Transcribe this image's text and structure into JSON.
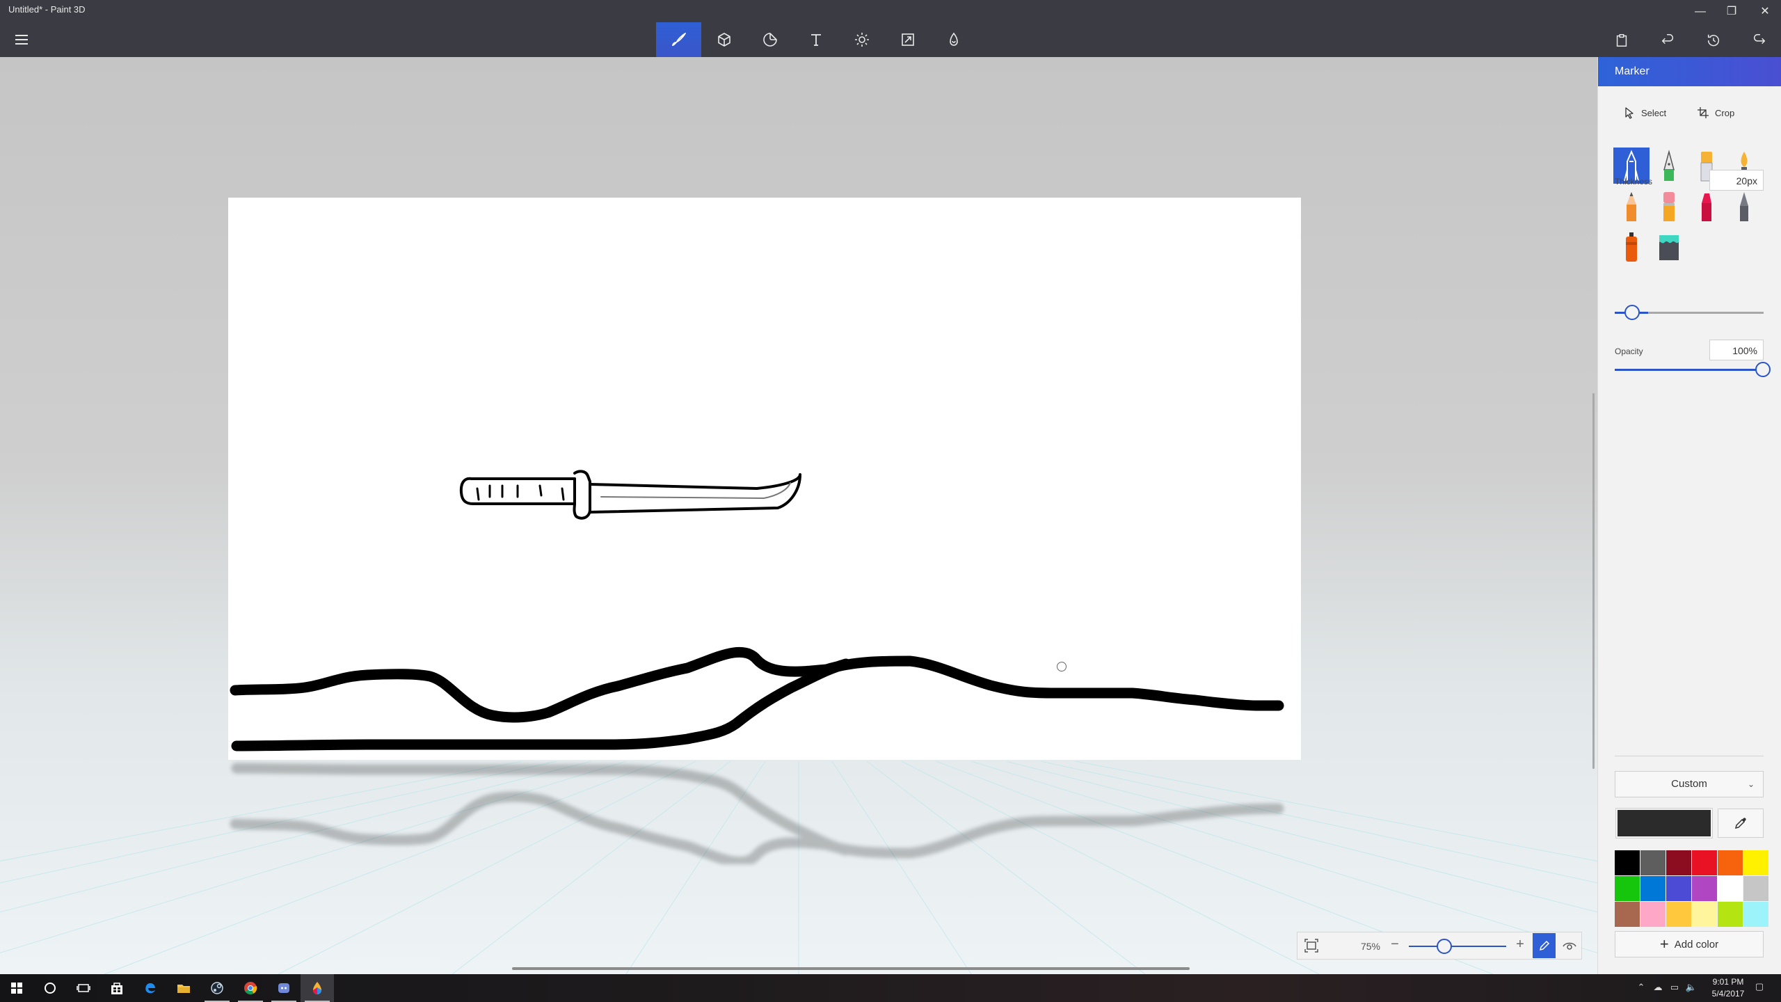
{
  "window": {
    "title": "Untitled* - Paint 3D",
    "minimize_glyph": "—",
    "restore_glyph": "❐",
    "close_glyph": "✕"
  },
  "toolbar": {
    "tabs": [
      "brushes-icon",
      "3d-objects-icon",
      "stickers-icon",
      "text-icon",
      "effects-icon",
      "canvas-icon",
      "remix3d-icon"
    ],
    "active_tab": "brushes",
    "actions": [
      "paste-icon",
      "undo-icon",
      "history-icon",
      "redo-icon"
    ]
  },
  "panel": {
    "title": "Marker",
    "select_label": "Select",
    "crop_label": "Crop",
    "brushes": [
      "marker",
      "calligraphy-pen",
      "oil-brush",
      "watercolor",
      "pencil",
      "eraser",
      "crayon",
      "pixel-pen",
      "spray-can",
      "fill"
    ],
    "selected_brush": "marker",
    "thickness_label": "Thickness",
    "thickness_value": "20px",
    "thickness_level": 0.2,
    "opacity_label": "Opacity",
    "opacity_value": "100%",
    "opacity_level": 1.0,
    "color_mode": "Custom",
    "current_color": "#2b2b2b",
    "palette": [
      "#000000",
      "#5e5e5e",
      "#8b0d1f",
      "#e81224",
      "#f7630c",
      "#fff100",
      "#16c60c",
      "#0078d7",
      "#4b4bd6",
      "#b146c2",
      "#ffffff",
      "#c6c6c6",
      "#a8684f",
      "#ffa7c6",
      "#ffc83d",
      "#fff59c",
      "#b4e411",
      "#9cf3f9"
    ],
    "add_color_label": "Add color"
  },
  "zoom": {
    "value": "75%",
    "minus": "−",
    "plus": "+"
  },
  "taskbar": {
    "apps": [
      "start-icon",
      "cortana-icon",
      "task-view-icon",
      "store-icon",
      "edge-icon",
      "file-explorer-icon",
      "steam-icon",
      "chrome-icon",
      "discord-icon",
      "paint3d-icon"
    ],
    "time": "9:01 PM",
    "date": "5/4/2017"
  }
}
